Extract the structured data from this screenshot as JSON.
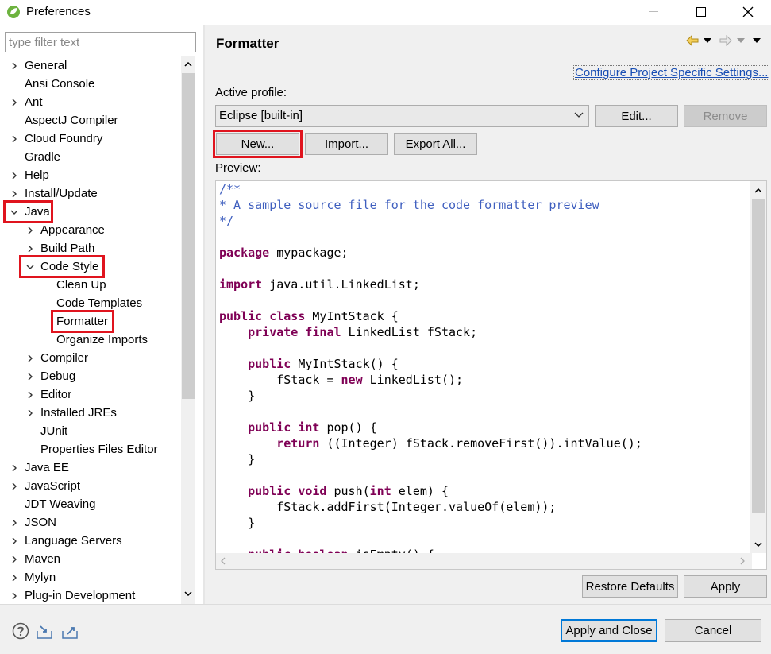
{
  "window": {
    "title": "Preferences",
    "minimize_glyph": "—",
    "maximize_glyph": "☐",
    "close_glyph": "✕"
  },
  "sidebar": {
    "filter_placeholder": "type filter text",
    "items": [
      {
        "label": "General",
        "arrow": "right"
      },
      {
        "label": "Ansi Console",
        "arrow": "none"
      },
      {
        "label": "Ant",
        "arrow": "right"
      },
      {
        "label": "AspectJ Compiler",
        "arrow": "none"
      },
      {
        "label": "Cloud Foundry",
        "arrow": "right"
      },
      {
        "label": "Gradle",
        "arrow": "none"
      },
      {
        "label": "Help",
        "arrow": "right"
      },
      {
        "label": "Install/Update",
        "arrow": "right"
      },
      {
        "label": "Java",
        "arrow": "down"
      },
      {
        "label": "Appearance",
        "arrow": "right"
      },
      {
        "label": "Build Path",
        "arrow": "right"
      },
      {
        "label": "Code Style",
        "arrow": "down"
      },
      {
        "label": "Clean Up",
        "arrow": "none"
      },
      {
        "label": "Code Templates",
        "arrow": "none"
      },
      {
        "label": "Formatter",
        "arrow": "none",
        "selected": true
      },
      {
        "label": "Organize Imports",
        "arrow": "none"
      },
      {
        "label": "Compiler",
        "arrow": "right"
      },
      {
        "label": "Debug",
        "arrow": "right"
      },
      {
        "label": "Editor",
        "arrow": "right"
      },
      {
        "label": "Installed JREs",
        "arrow": "right"
      },
      {
        "label": "JUnit",
        "arrow": "none"
      },
      {
        "label": "Properties Files Editor",
        "arrow": "none"
      },
      {
        "label": "Java EE",
        "arrow": "right"
      },
      {
        "label": "JavaScript",
        "arrow": "right"
      },
      {
        "label": "JDT Weaving",
        "arrow": "none"
      },
      {
        "label": "JSON",
        "arrow": "right"
      },
      {
        "label": "Language Servers",
        "arrow": "right"
      },
      {
        "label": "Maven",
        "arrow": "right"
      },
      {
        "label": "Mylyn",
        "arrow": "right"
      },
      {
        "label": "Plug-in Development",
        "arrow": "right"
      }
    ]
  },
  "page": {
    "title": "Formatter",
    "configure_link": "Configure Project Specific Settings...",
    "active_profile_label": "Active profile:",
    "profile_value": "Eclipse [built-in]",
    "edit_button": "Edit...",
    "remove_button": "Remove",
    "new_button": "New...",
    "import_button": "Import...",
    "export_button": "Export All...",
    "preview_label": "Preview:",
    "restore_defaults_button": "Restore Defaults",
    "apply_button": "Apply"
  },
  "preview_code": [
    {
      "text": "/**",
      "style": "cm"
    },
    {
      "text": "* A sample source file for the code formatter preview",
      "style": "cm"
    },
    {
      "text": "*/",
      "style": "cm"
    },
    {
      "text": "",
      "style": ""
    },
    {
      "parts": [
        {
          "t": "package",
          "s": "kw"
        },
        {
          "t": " mypackage;",
          "s": ""
        }
      ]
    },
    {
      "text": "",
      "style": ""
    },
    {
      "parts": [
        {
          "t": "import",
          "s": "kw"
        },
        {
          "t": " java.util.LinkedList;",
          "s": ""
        }
      ]
    },
    {
      "text": "",
      "style": ""
    },
    {
      "parts": [
        {
          "t": "public class",
          "s": "kw"
        },
        {
          "t": " MyIntStack {",
          "s": ""
        }
      ]
    },
    {
      "parts": [
        {
          "t": "    ",
          "s": ""
        },
        {
          "t": "private final",
          "s": "kw"
        },
        {
          "t": " LinkedList fStack;",
          "s": ""
        }
      ]
    },
    {
      "text": "",
      "style": ""
    },
    {
      "parts": [
        {
          "t": "    ",
          "s": ""
        },
        {
          "t": "public",
          "s": "kw"
        },
        {
          "t": " MyIntStack() {",
          "s": ""
        }
      ]
    },
    {
      "parts": [
        {
          "t": "        fStack = ",
          "s": ""
        },
        {
          "t": "new",
          "s": "kw"
        },
        {
          "t": " LinkedList();",
          "s": ""
        }
      ]
    },
    {
      "text": "    }",
      "style": ""
    },
    {
      "text": "",
      "style": ""
    },
    {
      "parts": [
        {
          "t": "    ",
          "s": ""
        },
        {
          "t": "public int",
          "s": "kw"
        },
        {
          "t": " pop() {",
          "s": ""
        }
      ]
    },
    {
      "parts": [
        {
          "t": "        ",
          "s": ""
        },
        {
          "t": "return",
          "s": "kw"
        },
        {
          "t": " ((Integer) fStack.removeFirst()).intValue();",
          "s": ""
        }
      ]
    },
    {
      "text": "    }",
      "style": ""
    },
    {
      "text": "",
      "style": ""
    },
    {
      "parts": [
        {
          "t": "    ",
          "s": ""
        },
        {
          "t": "public void",
          "s": "kw"
        },
        {
          "t": " push(",
          "s": ""
        },
        {
          "t": "int",
          "s": "kw"
        },
        {
          "t": " elem) {",
          "s": ""
        }
      ]
    },
    {
      "text": "        fStack.addFirst(Integer.valueOf(elem));",
      "style": ""
    },
    {
      "text": "    }",
      "style": ""
    },
    {
      "text": "",
      "style": ""
    },
    {
      "parts": [
        {
          "t": "    ",
          "s": ""
        },
        {
          "t": "public boolean",
          "s": "kw"
        },
        {
          "t": " isEmpty() {",
          "s": ""
        }
      ]
    }
  ],
  "footer": {
    "apply_and_close_button": "Apply and Close",
    "cancel_button": "Cancel",
    "icons": [
      "help-icon",
      "import-preferences-icon",
      "export-preferences-icon"
    ]
  },
  "colors": {
    "highlight_red": "#e0141e",
    "comment_blue": "#3f5fbf",
    "keyword_purple": "#7f0055",
    "link_blue": "#1a4fb4"
  }
}
